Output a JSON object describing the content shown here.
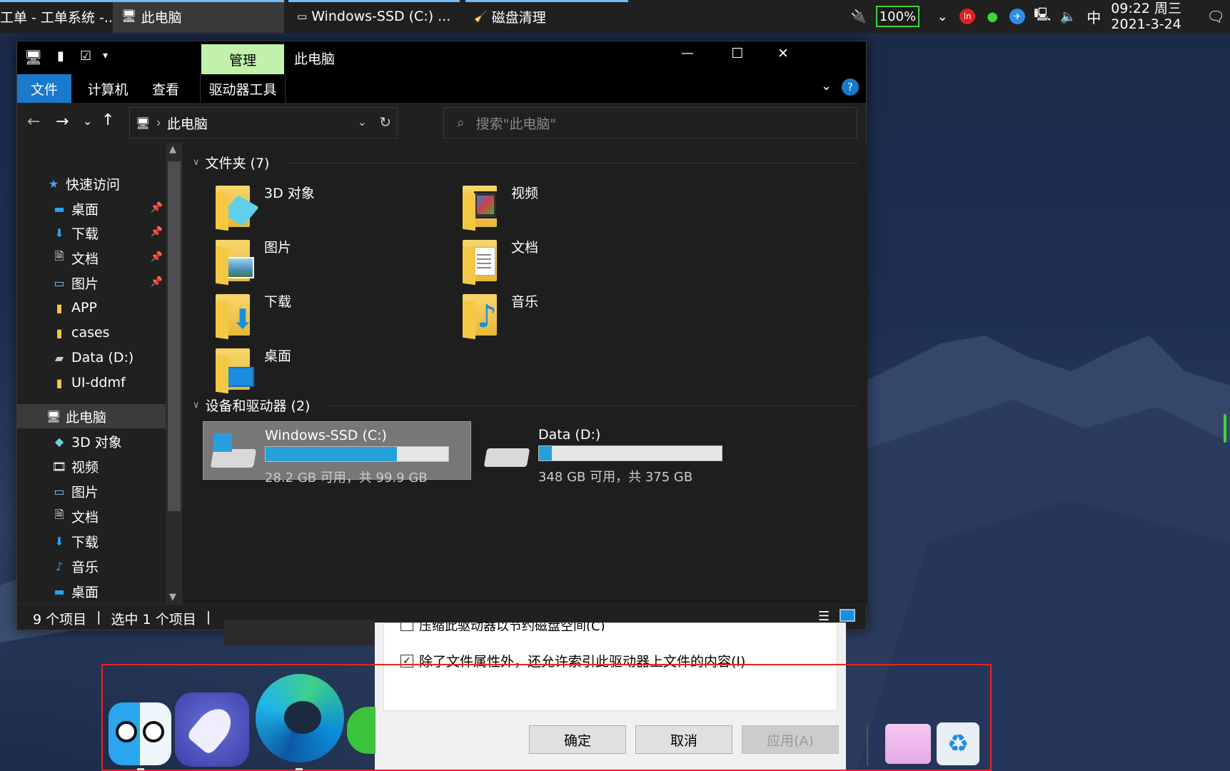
{
  "taskbar": {
    "buttons": [
      {
        "label": "工单 - 工单系统 -...",
        "active": false
      },
      {
        "label": "此电脑",
        "active": true
      },
      {
        "label": "Windows-SSD (C:) ...",
        "active": false
      },
      {
        "label": "磁盘清理",
        "active": false
      }
    ],
    "battery": "100%",
    "ime": "中",
    "time": "09:22 周三",
    "date": "2021-3-24"
  },
  "explorer": {
    "title": "此电脑",
    "contextual_tab": "管理",
    "ribbon_tabs": [
      "文件",
      "计算机",
      "查看",
      "驱动器工具"
    ],
    "window_controls": {
      "minimize": "—",
      "maximize": "☐",
      "close": "✕"
    },
    "help": "?",
    "address": {
      "path": "此电脑",
      "separator": "›"
    },
    "search": {
      "placeholder": "搜索\"此电脑\""
    },
    "nav": {
      "quick_access": "快速访问",
      "quick_items": [
        {
          "label": "桌面",
          "icon": "desktop-icon",
          "pinned": true
        },
        {
          "label": "下载",
          "icon": "download-icon",
          "pinned": true
        },
        {
          "label": "文档",
          "icon": "document-icon",
          "pinned": true
        },
        {
          "label": "图片",
          "icon": "picture-icon",
          "pinned": true
        },
        {
          "label": "APP",
          "icon": "folder-icon",
          "pinned": false
        },
        {
          "label": "cases",
          "icon": "folder-icon",
          "pinned": false
        },
        {
          "label": "Data (D:)",
          "icon": "drive-icon",
          "pinned": false
        },
        {
          "label": "UI-ddmf",
          "icon": "folder-icon",
          "pinned": false
        }
      ],
      "this_pc": "此电脑",
      "pc_items": [
        {
          "label": "3D 对象",
          "icon": "cube-icon"
        },
        {
          "label": "视频",
          "icon": "video-icon"
        },
        {
          "label": "图片",
          "icon": "picture-icon"
        },
        {
          "label": "文档",
          "icon": "document-icon"
        },
        {
          "label": "下载",
          "icon": "download-icon"
        },
        {
          "label": "音乐",
          "icon": "music-icon"
        },
        {
          "label": "桌面",
          "icon": "desktop-icon"
        }
      ]
    },
    "content": {
      "folders_header": "文件夹 (7)",
      "folders": [
        {
          "label": "3D 对象",
          "icon": "cube-folder-icon"
        },
        {
          "label": "视频",
          "icon": "video-folder-icon"
        },
        {
          "label": "图片",
          "icon": "picture-folder-icon"
        },
        {
          "label": "文档",
          "icon": "document-folder-icon"
        },
        {
          "label": "下载",
          "icon": "download-folder-icon"
        },
        {
          "label": "音乐",
          "icon": "music-folder-icon"
        },
        {
          "label": "桌面",
          "icon": "desktop-folder-icon"
        }
      ],
      "drives_header": "设备和驱动器 (2)",
      "drives": [
        {
          "label": "Windows-SSD (C:)",
          "detail": "28.2 GB 可用，共 99.9 GB",
          "used_fraction": 0.72,
          "selected": true
        },
        {
          "label": "Data (D:)",
          "detail": "348 GB 可用，共 375 GB",
          "used_fraction": 0.07,
          "selected": false
        }
      ]
    },
    "status": {
      "count": "9 个项目",
      "sep1": "|",
      "selected": "选中 1 个项目",
      "sep2": "|"
    }
  },
  "dialog": {
    "option_compress": "压缩此驱动器以节约磁盘空间(C)",
    "option_index": "除了文件属性外，还允许索引此驱动器上文件的内容(I)",
    "ok": "确定",
    "cancel": "取消",
    "apply": "应用(A)"
  },
  "colors": {
    "accent": "#0078d7",
    "drive_bar": "#26a0da",
    "battery": "#3cd43c",
    "dock_outline": "#e22222",
    "folder": "#f5c844"
  }
}
